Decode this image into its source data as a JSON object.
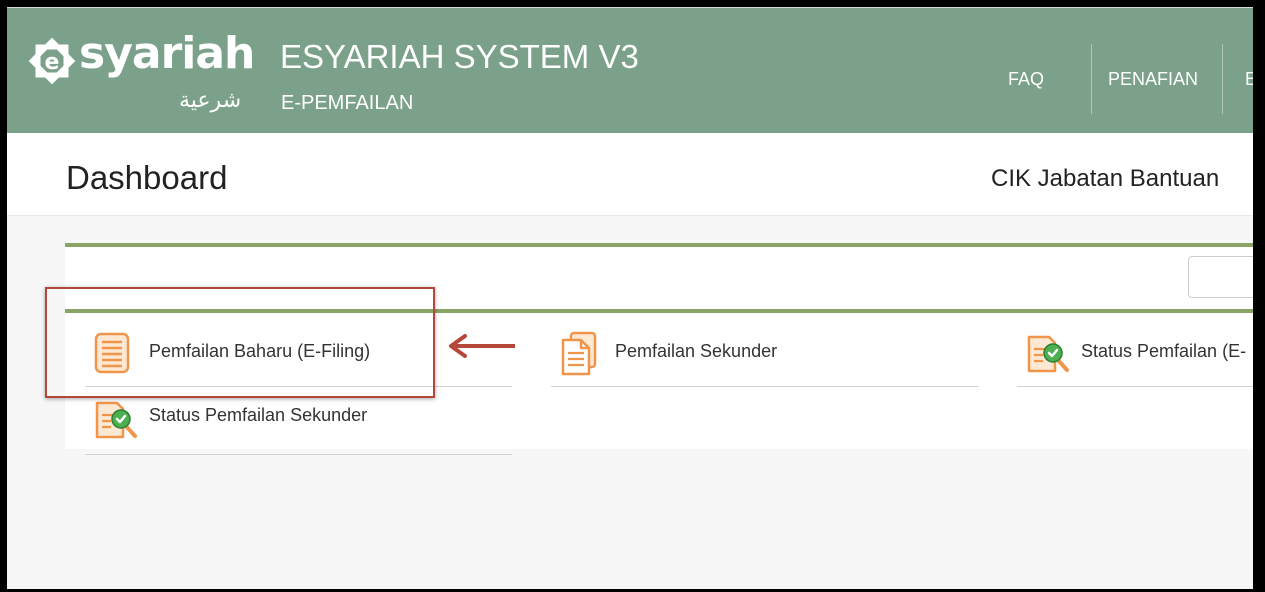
{
  "header": {
    "logo_text": "syariah",
    "logo_arabic": "شرعية",
    "title": "ESYARIAH SYSTEM V3",
    "subtitle": "E-PEMFAILAN",
    "nav": [
      {
        "label": "FAQ"
      },
      {
        "label": "PENAFIAN"
      },
      {
        "label": "E"
      }
    ]
  },
  "page": {
    "title": "Dashboard",
    "user": "CIK Jabatan Bantuan"
  },
  "menu": [
    {
      "label": "Pemfailan Baharu (E-Filing)",
      "icon": "document-list-icon"
    },
    {
      "label": "Pemfailan Sekunder",
      "icon": "documents-icon"
    },
    {
      "label": "Status Pemfailan (E-",
      "icon": "document-check-search-icon"
    },
    {
      "label": "Status Pemfailan Sekunder",
      "icon": "document-check-search-icon"
    }
  ],
  "colors": {
    "header_bg": "#7ba18a",
    "panel_rule": "#8aa465",
    "icon_orange": "#f0954a",
    "annotation_red": "#b5473a"
  }
}
